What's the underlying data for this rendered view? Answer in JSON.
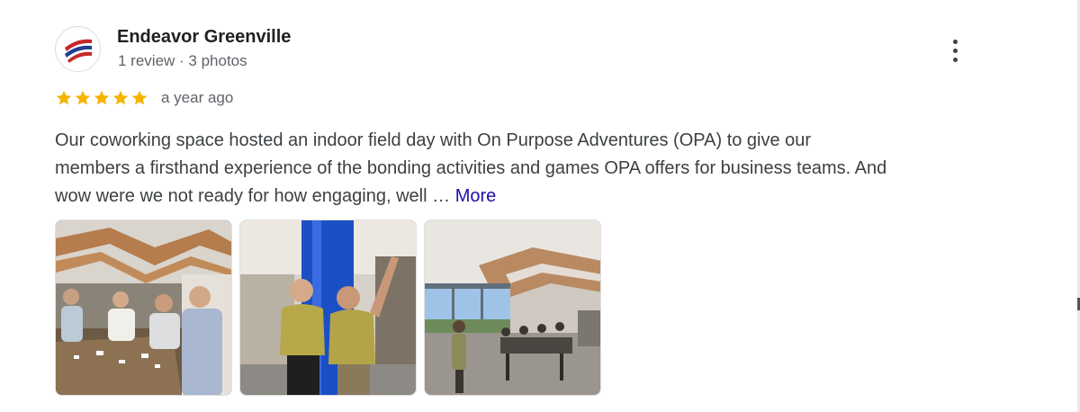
{
  "reviewer": {
    "name": "Endeavor Greenville",
    "meta": "1 review · 3 photos"
  },
  "review": {
    "rating": 5,
    "date": "a year ago",
    "text_lines": [
      "Our coworking space hosted an indoor field day with On Purpose Adventures (OPA) to give our",
      "members a firsthand experience of the bonding activities and games OPA offers for business teams. And",
      "wow were we not ready for how engaging, well …"
    ],
    "more_label": "More"
  },
  "photos": [
    {
      "icon": "photo-group-at-table"
    },
    {
      "icon": "photo-two-men-by-blue-pillar"
    },
    {
      "icon": "photo-coworking-lounge"
    }
  ],
  "colors": {
    "star": "#f5b400",
    "link": "#1a0dab",
    "name": "#202124",
    "meta": "#5f6368"
  }
}
